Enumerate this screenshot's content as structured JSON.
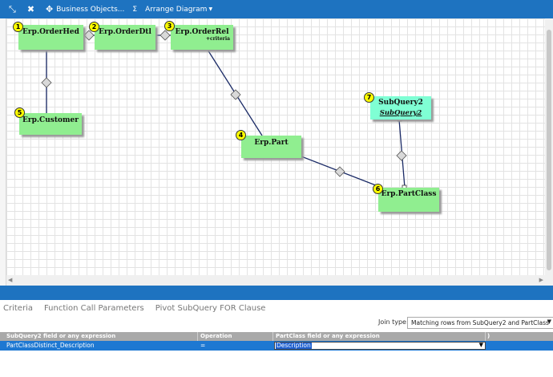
{
  "toolbar": {
    "business_objects": "Business Objects...",
    "sigma": "Σ",
    "arrange": "Arrange Diagram"
  },
  "diagram": {
    "nodes": [
      {
        "num": "1",
        "title": "Erp.OrderHed"
      },
      {
        "num": "2",
        "title": "Erp.OrderDtl"
      },
      {
        "num": "3",
        "title": "Erp.OrderRel",
        "extra": "+criteria"
      },
      {
        "num": "4",
        "title": "Erp.Part"
      },
      {
        "num": "5",
        "title": "Erp.Customer"
      },
      {
        "num": "6",
        "title": "Erp.PartClass"
      },
      {
        "num": "7",
        "title": "SubQuery2",
        "subtext": "SubQuery2"
      }
    ]
  },
  "bottom": {
    "tabs": [
      "Criteria",
      "Function Call Parameters",
      "Pivot SubQuery FOR Clause"
    ],
    "join_type_label": "Join type:",
    "join_type_value": "Matching rows from SubQuery2 and PartClass",
    "grid": {
      "headers": [
        "SubQuery2 field or any expression",
        "Operation",
        "PartClass field or any expression",
        ")"
      ],
      "row": {
        "left": "PartClassDistinct_Description",
        "op": "=",
        "right": "Description"
      }
    }
  },
  "colors": {
    "accent": "#1e73c0",
    "table_node": "#90ee90",
    "subquery_node": "#7fffd4",
    "badge": "#ffff00",
    "selected_row": "#1e78d2"
  }
}
